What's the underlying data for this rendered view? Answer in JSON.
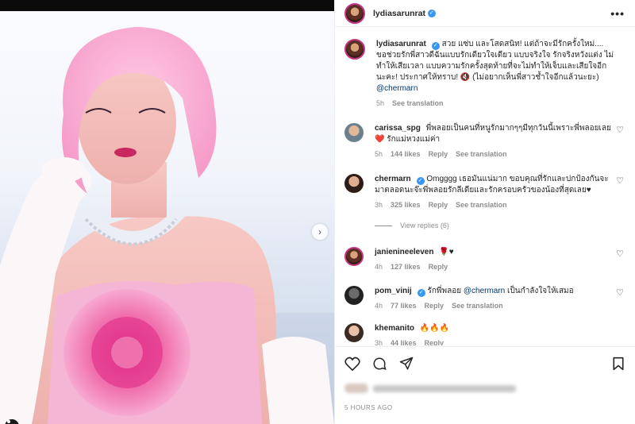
{
  "post": {
    "author": "lydiasarunrat",
    "caption": "สวย แซ่บ และโสดสนิท! แต่ถ้าจะมีรักครั้งใหม่.... ขอช่วยรักพี่สาวดีฉันแบบรักเดียวใจเดียว แบบจริงใจ รักจริงหวังแต่ง ไม่ทำให้เสียเวลา แบบความรักครั้งสุดท้ายที่จะไม่ทำให้เจ็บและเสียใจอีกนะคะ! ประกาศให้ทราบ! 🔇 (ไม่อยากเห็นพี่สาวช้ำใจอีกแล้วนะยะ)",
    "caption_mention": "@chermarn",
    "caption_age": "5h",
    "see_translation": "See translation",
    "time_ago": "5 HOURS AGO",
    "more_label": "•••"
  },
  "comments": [
    {
      "user": "carissa_spg",
      "text": "พี่พลอยเป็นคนที่หนูรักมากๆๆมีทุกวันนี้เพราะพี่พลอยเลย ❤️ รักแม่หวงแม่ค่า",
      "age": "5h",
      "likes": "144 likes",
      "reply": "Reply",
      "translate": "See translation"
    },
    {
      "user": "chermarn",
      "text": "Omgggg เธอมันแน่มาก ขอบคุณที่รักและปกป้องกันจะมาตลอดนะจ๊ะพี่พลอยรักลีเดียและรักครอบครัวของน้องที่สุดเลย♥",
      "age": "3h",
      "likes": "325 likes",
      "reply": "Reply",
      "translate": "See translation",
      "view_replies": "View replies (6)"
    },
    {
      "user": "janienineeleven",
      "text": "🌹♥",
      "age": "4h",
      "likes": "127 likes",
      "reply": "Reply"
    },
    {
      "user": "pom_vinij",
      "text": "รักพี่พลอย",
      "mention": "@chermarn",
      "text2": "เป็นกำลังใจให้เสมอ",
      "age": "4h",
      "likes": "77 likes",
      "reply": "Reply",
      "translate": "See translation"
    },
    {
      "user": "khemanito",
      "text": "🔥🔥🔥",
      "age": "3h",
      "likes": "44 likes",
      "reply": "Reply"
    }
  ],
  "colors": {
    "accent": "#3897f0",
    "mention": "#00376b",
    "muted": "#8e8e8e"
  },
  "icons": [
    "heart-icon",
    "comment-icon",
    "share-icon",
    "save-icon",
    "tag-person-icon",
    "chevron-right-icon"
  ]
}
